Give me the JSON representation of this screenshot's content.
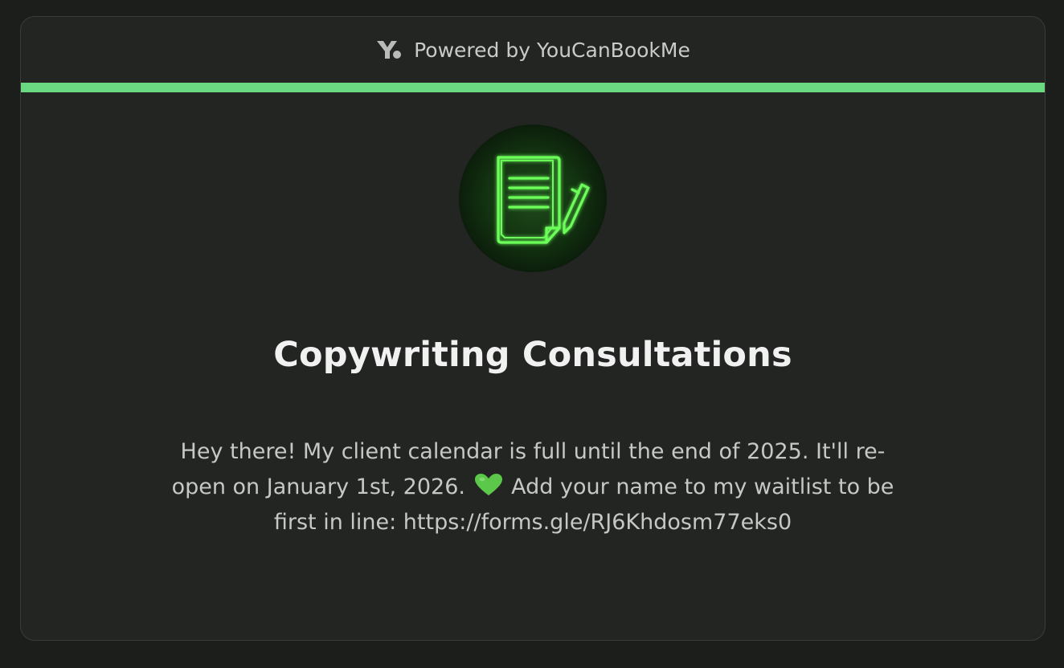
{
  "header": {
    "powered_by_text": "Powered by YouCanBookMe",
    "logo_icon": "youcanbookme-logo-icon"
  },
  "colors": {
    "accent": "#6bd882",
    "card_background": "#232523",
    "page_background": "#1c1e1c",
    "neon_green": "#6cff5a"
  },
  "profile": {
    "avatar_icon": "document-with-pencil-icon"
  },
  "booking": {
    "title": "Copywriting Consultations",
    "description_part1": "Hey there! My client calendar is full until the end of 2025. It'll re-\nopen on January 1st, 2026.",
    "heart_icon": "green-heart-emoji",
    "description_part2": "Add your name to my waitlist to be\nfirst in line: https://forms.gle/RJ6Khdosm77eks0"
  }
}
